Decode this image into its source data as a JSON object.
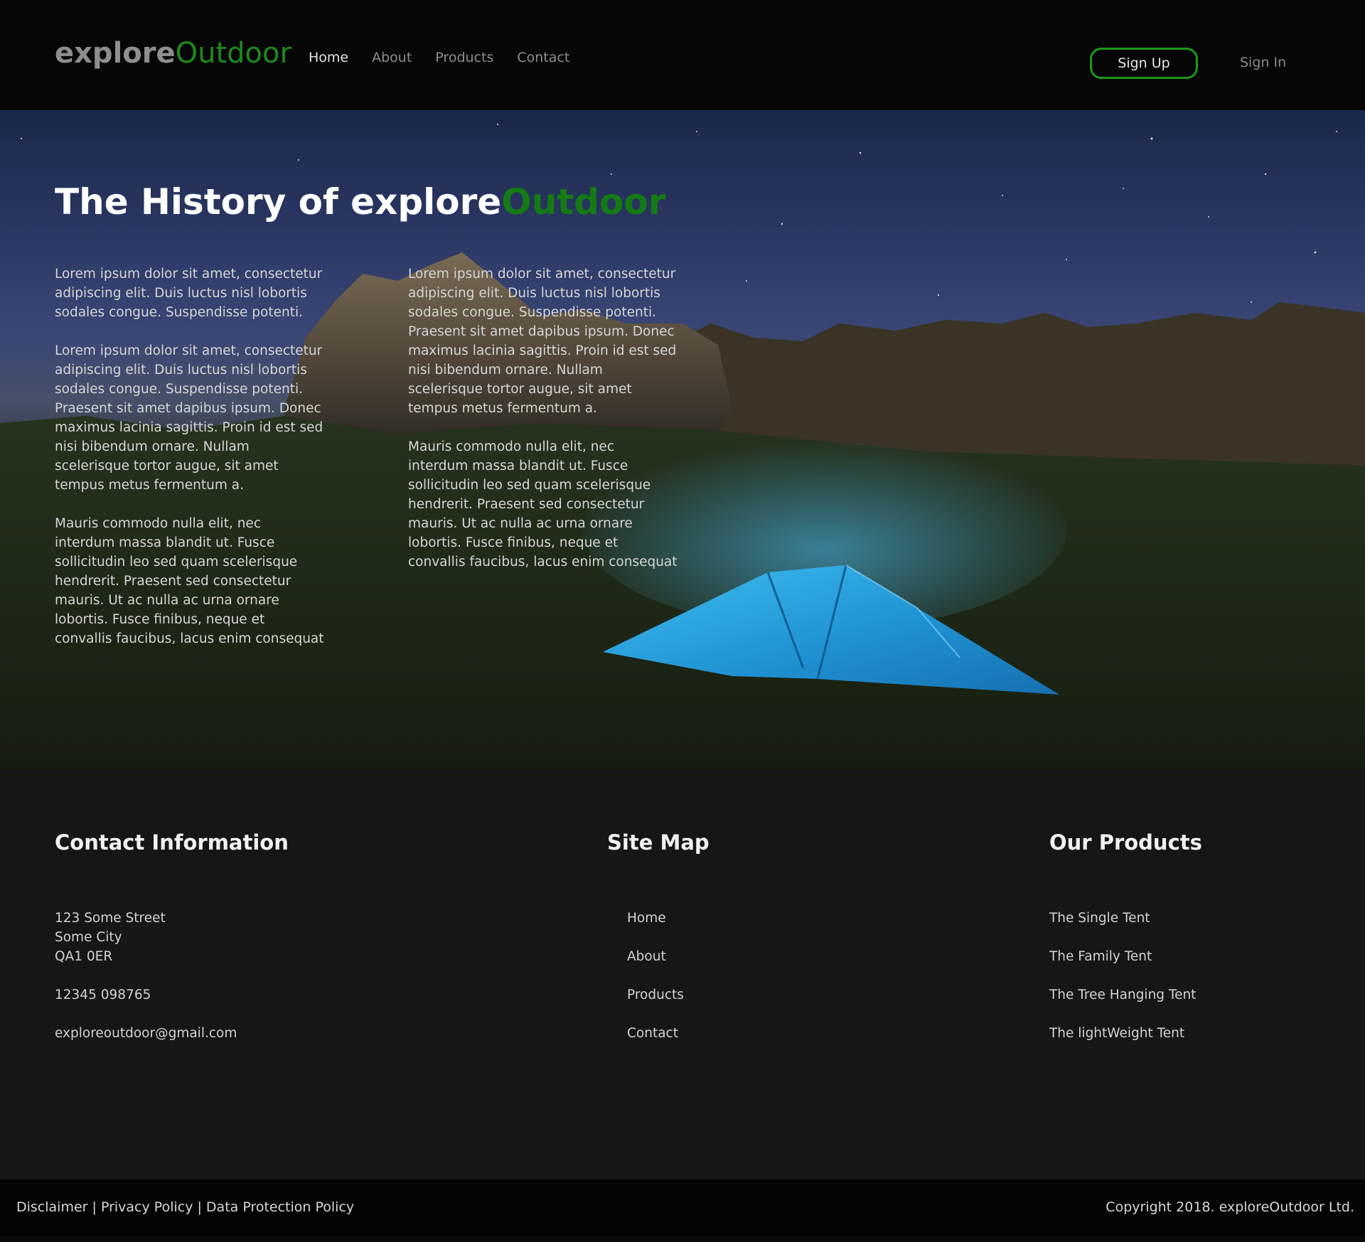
{
  "header": {
    "logo": {
      "part1": "explore",
      "part2": "Outdoor"
    },
    "nav": [
      {
        "label": "Home",
        "active": true
      },
      {
        "label": "About",
        "active": false
      },
      {
        "label": "Products",
        "active": false
      },
      {
        "label": "Contact",
        "active": false
      }
    ],
    "signup_label": "Sign Up",
    "signin_label": "Sign In"
  },
  "hero": {
    "title_part1": "The History of explore",
    "title_part2": "Outdoor",
    "col1": [
      "Lorem ipsum dolor sit amet, consectetur adipiscing elit. Duis luctus nisl lobortis sodales congue. Suspendisse potenti.",
      "Lorem ipsum dolor sit amet, consectetur adipiscing elit. Duis luctus nisl lobortis sodales congue. Suspendisse potenti. Praesent sit amet dapibus ipsum. Donec maximus lacinia sagittis. Proin id est sed nisi bibendum ornare. Nullam scelerisque tortor augue, sit amet tempus metus fermentum a.",
      "Mauris commodo nulla elit, nec interdum massa blandit ut. Fusce sollicitudin leo sed quam scelerisque hendrerit. Praesent sed consectetur mauris. Ut ac nulla ac urna ornare lobortis. Fusce finibus, neque et convallis faucibus, lacus enim consequat"
    ],
    "col2": [
      "Lorem ipsum dolor sit amet, consectetur adipiscing elit. Duis luctus nisl lobortis sodales congue. Suspendisse potenti. Praesent sit amet dapibus ipsum. Donec maximus lacinia sagittis. Proin id est sed nisi bibendum ornare. Nullam scelerisque tortor augue, sit amet tempus metus fermentum a.",
      "Mauris commodo nulla elit, nec interdum massa blandit ut. Fusce sollicitudin leo sed quam scelerisque hendrerit. Praesent sed consectetur mauris. Ut ac nulla ac urna ornare lobortis. Fusce finibus, neque et convallis faucibus, lacus enim consequat"
    ]
  },
  "footer": {
    "contact": {
      "heading": "Contact Information",
      "street": "123 Some Street",
      "city": "Some City",
      "postcode": "QA1 0ER",
      "phone": "12345 098765",
      "email": "exploreoutdoor@gmail.com"
    },
    "sitemap": {
      "heading": "Site Map",
      "links": [
        "Home",
        "About",
        "Products",
        "Contact"
      ]
    },
    "products": {
      "heading": "Our Products",
      "items": [
        "The Single Tent",
        "The Family Tent",
        "The Tree Hanging Tent",
        "The lightWeight Tent"
      ]
    },
    "legal": {
      "disclaimer": "Disclaimer",
      "privacy": "Privacy Policy",
      "data_protection": "Data Protection Policy",
      "separator": " | "
    },
    "copyright": "Copyright  2018. exploreOutdoor Ltd."
  },
  "colors": {
    "brand_green": "#1a9a1a",
    "header_bg": "#060606",
    "footer_bg": "#161616"
  }
}
